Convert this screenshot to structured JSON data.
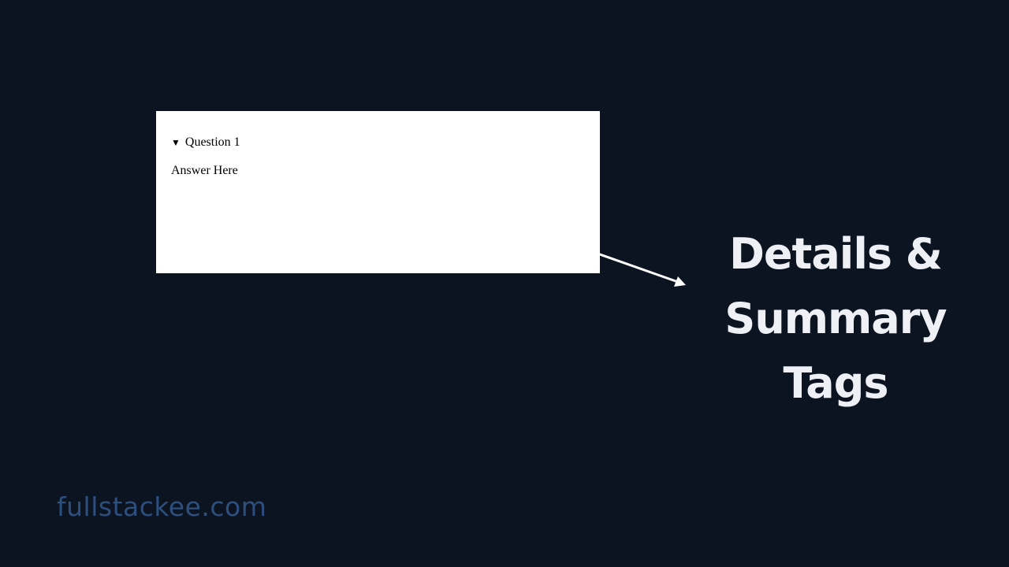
{
  "details": {
    "summary_marker": "▼",
    "summary_label": "Question 1",
    "answer_text": "Answer Here"
  },
  "headline": {
    "line1": "Details &",
    "line2": "Summary Tags"
  },
  "footer": {
    "site": "fullstackee.com"
  },
  "colors": {
    "background": "#0d1421",
    "panel": "#ffffff",
    "headline": "#eef0f6",
    "site": "#2d4f7e"
  }
}
